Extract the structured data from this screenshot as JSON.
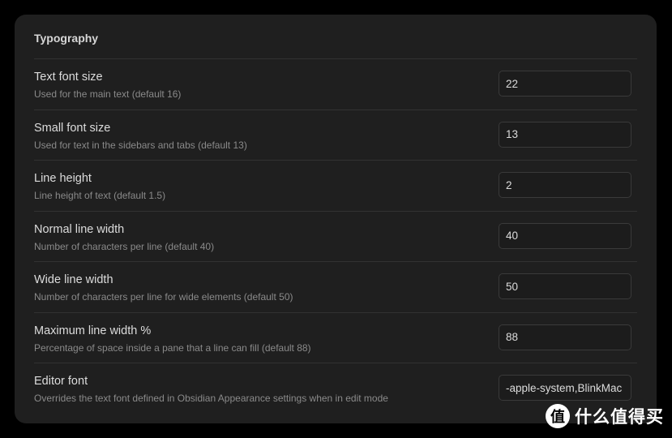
{
  "section": {
    "title": "Typography"
  },
  "settings": [
    {
      "name": "Text font size",
      "description": "Used for the main text (default 16)",
      "value": "22"
    },
    {
      "name": "Small font size",
      "description": "Used for text in the sidebars and tabs (default 13)",
      "value": "13"
    },
    {
      "name": "Line height",
      "description": "Line height of text (default 1.5)",
      "value": "2"
    },
    {
      "name": "Normal line width",
      "description": "Number of characters per line (default 40)",
      "value": "40"
    },
    {
      "name": "Wide line width",
      "description": "Number of characters per line for wide elements (default 50)",
      "value": "50"
    },
    {
      "name": "Maximum line width %",
      "description": "Percentage of space inside a pane that a line can fill (default 88)",
      "value": "88"
    },
    {
      "name": "Editor font",
      "description": "Overrides the text font defined in Obsidian Appearance settings when in edit mode",
      "value": "-apple-system,BlinkMac"
    }
  ],
  "watermark": {
    "logo_glyph": "值",
    "text": "什么值得买"
  }
}
